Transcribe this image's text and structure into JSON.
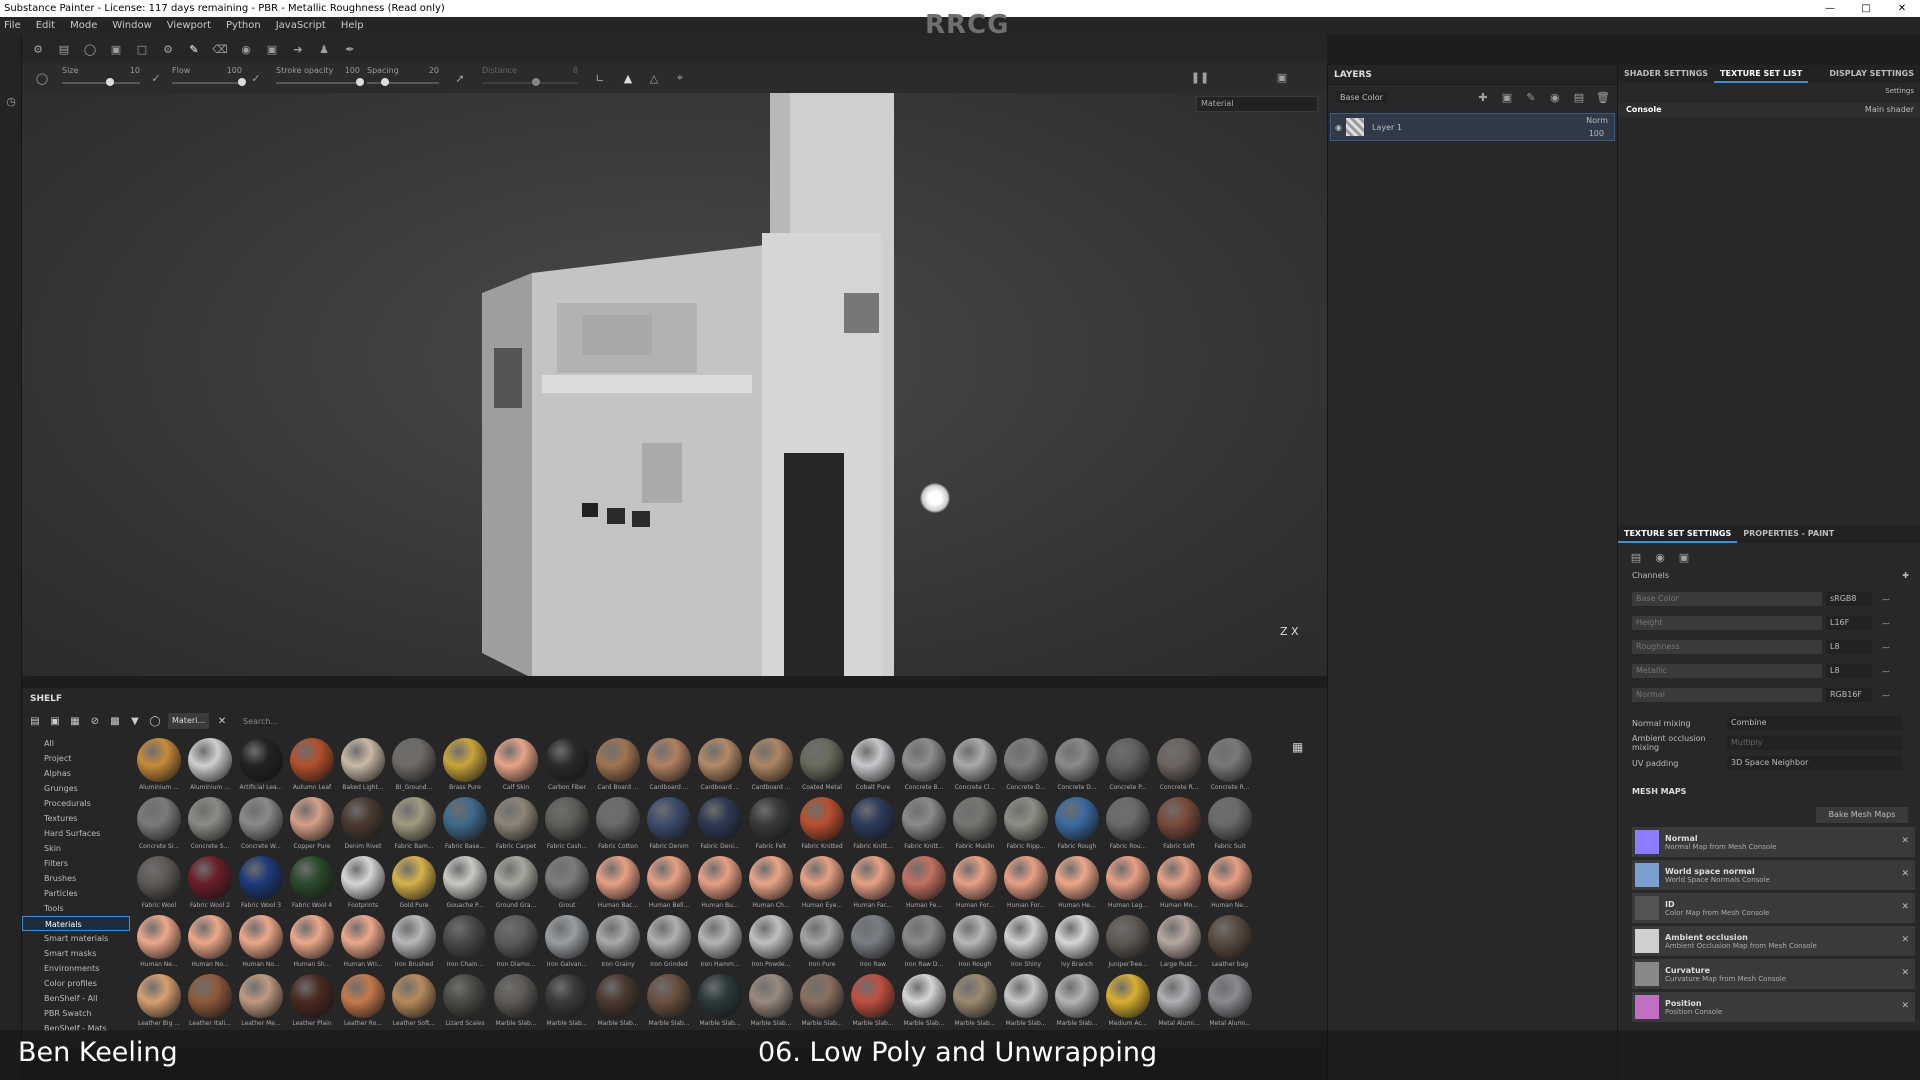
{
  "window": {
    "title": "Substance Painter - License: 117 days remaining - PBR - Metallic Roughness (Read only)",
    "brand": "RRCG"
  },
  "menu": [
    "File",
    "Edit",
    "Mode",
    "Window",
    "Viewport",
    "Python",
    "JavaScript",
    "Help"
  ],
  "brush": {
    "size_label": "Size",
    "size_value": "10",
    "flow_label": "Flow",
    "flow_value": "100",
    "stroke_label": "Stroke opacity",
    "stroke_value": "100",
    "spacing_label": "Spacing",
    "spacing_value": "20",
    "distance_label": "Distance",
    "distance_value": "8"
  },
  "viewport": {
    "material_mode": "Material",
    "axis": "Z  X"
  },
  "layers": {
    "title": "LAYERS",
    "channel": "Base Color",
    "layer_name": "Layer 1",
    "blend": "Norm",
    "opacity": "100"
  },
  "right_tabs": [
    "SHADER SETTINGS",
    "TEXTURE SET LIST",
    "DISPLAY SETTINGS"
  ],
  "texture_set": {
    "settings_label": "Settings",
    "name": "Console",
    "shader": "Main shader"
  },
  "tss_tabs": [
    "TEXTURE SET SETTINGS",
    "PROPERTIES - PAINT"
  ],
  "channels_label": "Channels",
  "channels": [
    {
      "name": "Base Color",
      "format": "sRGB8"
    },
    {
      "name": "Height",
      "format": "L16F"
    },
    {
      "name": "Roughness",
      "format": "L8"
    },
    {
      "name": "Metallic",
      "format": "L8"
    },
    {
      "name": "Normal",
      "format": "RGB16F"
    }
  ],
  "options": [
    {
      "k": "Normal mixing",
      "v": "Combine"
    },
    {
      "k": "Ambient occlusion mixing",
      "v": "Multiply"
    },
    {
      "k": "UV padding",
      "v": "3D Space Neighbor"
    }
  ],
  "mesh_maps": {
    "title": "MESH MAPS",
    "bake_button": "Bake Mesh Maps",
    "items": [
      {
        "t": "Normal",
        "s": "Normal Map from Mesh Console",
        "c": "#8a7bff"
      },
      {
        "t": "World space normal",
        "s": "World Space Normals Console",
        "c": "#7aa0d0"
      },
      {
        "t": "ID",
        "s": "Color Map from Mesh Console",
        "c": "#555555"
      },
      {
        "t": "Ambient occlusion",
        "s": "Ambient Occlusion Map from Mesh Console",
        "c": "#cfcfcf"
      },
      {
        "t": "Curvature",
        "s": "Curvature Map from Mesh Console",
        "c": "#888888"
      },
      {
        "t": "Position",
        "s": "Position Console",
        "c": "#c070c0"
      }
    ]
  },
  "shelf": {
    "title": "SHELF",
    "filter_tag": "Materi...",
    "search_placeholder": "Search...",
    "categories": [
      "All",
      "Project",
      "Alphas",
      "Grunges",
      "Procedurals",
      "Textures",
      "Hard Surfaces",
      "Skin",
      "Filters",
      "Brushes",
      "Particles",
      "Tools",
      "Materials",
      "Smart materials",
      "Smart masks",
      "Environments",
      "Color profiles",
      "BenShelf - All",
      "PBR Swatch",
      "BenShelf - Mats"
    ],
    "selected": "Materials",
    "materials": [
      {
        "n": "Aluminium ...",
        "c": "#c88a3a"
      },
      {
        "n": "Aluminium ...",
        "c": "#cfcfcf"
      },
      {
        "n": "Artificial Lea...",
        "c": "#222222"
      },
      {
        "n": "Autumn Leaf",
        "c": "#b4502a"
      },
      {
        "n": "Baked Light...",
        "c": "#c9b9a6"
      },
      {
        "n": "BI_Ground...",
        "c": "#6e6a66"
      },
      {
        "n": "Brass Pure",
        "c": "#c9a43a"
      },
      {
        "n": "Calf Skin",
        "c": "#e8a487"
      },
      {
        "n": "Carbon Fiber",
        "c": "#2a2a2a"
      },
      {
        "n": "Card Board ...",
        "c": "#a07450"
      },
      {
        "n": "Cardboard ...",
        "c": "#b08060"
      },
      {
        "n": "Cardboard ...",
        "c": "#b48a66"
      },
      {
        "n": "Cardboard ...",
        "c": "#ad8663"
      },
      {
        "n": "Coated Metal",
        "c": "#6a6a5c"
      },
      {
        "n": "Cobalt Pure",
        "c": "#c8c8cc"
      },
      {
        "n": "Concrete B...",
        "c": "#8e8e8c"
      },
      {
        "n": "Concrete Cl...",
        "c": "#aaaaaa"
      },
      {
        "n": "Concrete D...",
        "c": "#7e7e7c"
      },
      {
        "n": "Concrete D...",
        "c": "#8a8a88"
      },
      {
        "n": "Concrete P...",
        "c": "#606060"
      },
      {
        "n": "Concrete R...",
        "c": "#6c6460"
      },
      {
        "n": "Concrete R...",
        "c": "#787878"
      },
      {
        "n": "Concrete Si...",
        "c": "#7a7a78"
      },
      {
        "n": "Concrete S...",
        "c": "#8c8a84"
      },
      {
        "n": "Concrete W...",
        "c": "#8a8a8a"
      },
      {
        "n": "Copper Pure",
        "c": "#d6a088"
      },
      {
        "n": "Denim Rivet",
        "c": "#4a3a30"
      },
      {
        "n": "Fabric Bam...",
        "c": "#a09a80"
      },
      {
        "n": "Fabric Base...",
        "c": "#3e6a8a"
      },
      {
        "n": "Fabric Carpet",
        "c": "#8e8676"
      },
      {
        "n": "Fabric Cash...",
        "c": "#5e5e5a"
      },
      {
        "n": "Fabric Cotton",
        "c": "#6a6a6a"
      },
      {
        "n": "Fabric Denim",
        "c": "#3c4c6c"
      },
      {
        "n": "Fabric Deni...",
        "c": "#2e3a52"
      },
      {
        "n": "Fabric Felt",
        "c": "#3a3a3a"
      },
      {
        "n": "Fabric Knitted",
        "c": "#b8502e"
      },
      {
        "n": "Fabric Knitt...",
        "c": "#2c3c5c"
      },
      {
        "n": "Fabric Knitt...",
        "c": "#8a8a8a"
      },
      {
        "n": "Fabric Muslin",
        "c": "#767672"
      },
      {
        "n": "Fabric Ripp...",
        "c": "#8e8e86"
      },
      {
        "n": "Fabric Rough",
        "c": "#3a6aa0"
      },
      {
        "n": "Fabric Rou...",
        "c": "#6a6a6a"
      },
      {
        "n": "Fabric Soft",
        "c": "#7a4a3a"
      },
      {
        "n": "Fabric Suit",
        "c": "#6a6a6a"
      },
      {
        "n": "Fabric Wool",
        "c": "#5e5a56"
      },
      {
        "n": "Fabric Wool 2",
        "c": "#6a1e28"
      },
      {
        "n": "Fabric Wool 3",
        "c": "#1e3a7a"
      },
      {
        "n": "Fabric Wool 4",
        "c": "#2a4a2a"
      },
      {
        "n": "Footprints",
        "c": "#d6d6d6"
      },
      {
        "n": "Gold Pure",
        "c": "#d6b24a"
      },
      {
        "n": "Gouache P...",
        "c": "#c8c8c4"
      },
      {
        "n": "Ground Gra...",
        "c": "#a8a8a0"
      },
      {
        "n": "Grout",
        "c": "#7c7c7a"
      },
      {
        "n": "Human Bac...",
        "c": "#e8a084"
      },
      {
        "n": "Human Bell...",
        "c": "#e8a084"
      },
      {
        "n": "Human Bu...",
        "c": "#e8a084"
      },
      {
        "n": "Human Ch...",
        "c": "#eba688"
      },
      {
        "n": "Human Eye...",
        "c": "#e8a084"
      },
      {
        "n": "Human Fac...",
        "c": "#e8a084"
      },
      {
        "n": "Human Fe...",
        "c": "#c47060"
      },
      {
        "n": "Human For...",
        "c": "#e8a084"
      },
      {
        "n": "Human For...",
        "c": "#e8a084"
      },
      {
        "n": "Human He...",
        "c": "#eca88a"
      },
      {
        "n": "Human Leg...",
        "c": "#e8a084"
      },
      {
        "n": "Human Mo...",
        "c": "#e8a084"
      },
      {
        "n": "Human Ne...",
        "c": "#e8a084"
      },
      {
        "n": "Human Ne...",
        "c": "#eca88a"
      },
      {
        "n": "Human No...",
        "c": "#eca88a"
      },
      {
        "n": "Human No...",
        "c": "#eca88a"
      },
      {
        "n": "Human Sh...",
        "c": "#eca88a"
      },
      {
        "n": "Human Wri...",
        "c": "#eca88a"
      },
      {
        "n": "Iron Brushed",
        "c": "#b8b8b8"
      },
      {
        "n": "Iron Chain...",
        "c": "#4a4a4a"
      },
      {
        "n": "Iron Diamo...",
        "c": "#5c5c5c"
      },
      {
        "n": "Iron Galvan...",
        "c": "#9a9ea2"
      },
      {
        "n": "Iron Grainy",
        "c": "#a8a8a8"
      },
      {
        "n": "Iron Grinded",
        "c": "#b0b0b0"
      },
      {
        "n": "Iron Hamm...",
        "c": "#b4b4b4"
      },
      {
        "n": "Iron Powde...",
        "c": "#c0c0c0"
      },
      {
        "n": "Iron Pure",
        "c": "#a4a4a4"
      },
      {
        "n": "Iron Raw",
        "c": "#7a7e84"
      },
      {
        "n": "Iron Raw D...",
        "c": "#8a8a8a"
      },
      {
        "n": "Iron Rough",
        "c": "#b8b8b8"
      },
      {
        "n": "Iron Shiny",
        "c": "#d0d0d0"
      },
      {
        "n": "Ivy Branch",
        "c": "#d6d6d6"
      },
      {
        "n": "JuniperTree...",
        "c": "#5e5852"
      },
      {
        "n": "Large Rust...",
        "c": "#b8a8a0"
      },
      {
        "n": "Leather bag",
        "c": "#5a4a3e"
      },
      {
        "n": "Leather Big ...",
        "c": "#d8a070"
      },
      {
        "n": "Leather Itali...",
        "c": "#8e5a3a"
      },
      {
        "n": "Leather Me...",
        "c": "#bf9a80"
      },
      {
        "n": "Leather Plain",
        "c": "#4a2a20"
      },
      {
        "n": "Leather Ro...",
        "c": "#c47a4a"
      },
      {
        "n": "Leather Soft...",
        "c": "#b88a5a"
      },
      {
        "n": "Lizard Scales",
        "c": "#4a4a46"
      },
      {
        "n": "Marble Slab...",
        "c": "#5e5a56"
      },
      {
        "n": "Marble Slab...",
        "c": "#3a3a3a"
      },
      {
        "n": "Marble Slab...",
        "c": "#4a3a30"
      },
      {
        "n": "Marble Slab...",
        "c": "#6a5040"
      },
      {
        "n": "Marble Slab...",
        "c": "#2a3a3a"
      },
      {
        "n": "Marble Slab...",
        "c": "#9a8a80"
      },
      {
        "n": "Marble Slab...",
        "c": "#8a7060"
      },
      {
        "n": "Marble Slab...",
        "c": "#c05040"
      },
      {
        "n": "Marble Slab...",
        "c": "#d6d6d6"
      },
      {
        "n": "Marble Slab...",
        "c": "#9a8a70"
      },
      {
        "n": "Marble Slab...",
        "c": "#c8c8c8"
      },
      {
        "n": "Marble Slab...",
        "c": "#b4b4b4"
      },
      {
        "n": "Medium Ac...",
        "c": "#d8b030"
      },
      {
        "n": "Metal Alumi...",
        "c": "#b0b0b4"
      },
      {
        "n": "Metal Alumi...",
        "c": "#8a8a90"
      }
    ]
  },
  "video": {
    "author": "Ben Keeling",
    "lesson": "06. Low Poly and Unwrapping"
  }
}
